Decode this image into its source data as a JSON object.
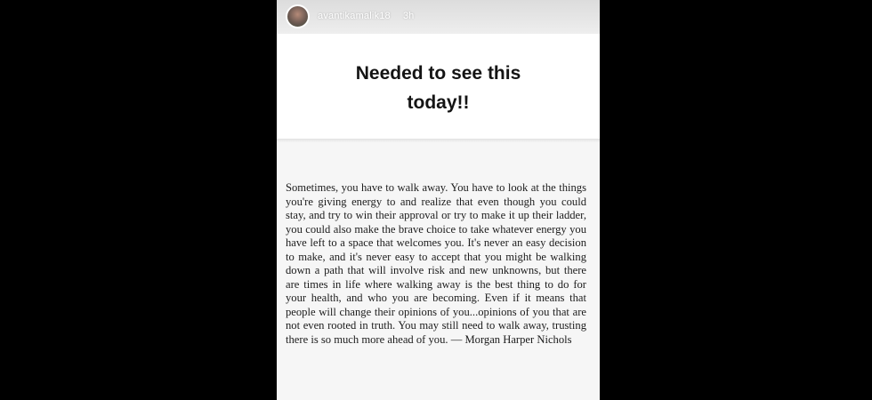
{
  "story": {
    "username": "avantikamalik18",
    "timestamp": "3h",
    "caption_line1": "Needed to see this",
    "caption_line2": "today!!",
    "quote": "Sometimes, you have to walk away. You have to look at the things you're giving energy to and realize that even though you could stay, and try to win their approval or try to make it up their ladder, you could also make the brave choice to take whatever energy you have left to a space that welcomes you. It's never an easy decision to make, and it's never easy to accept that you might be walking down a path that will involve risk and new unknowns, but there are times in life where walking away is the best thing to do for your health, and who you are becoming. Even if it means that people will change their opinions of you...opinions of you that are not even rooted in truth. You may still need to walk away, trusting there is so much more ahead of you. — Morgan Harper Nichols"
  }
}
